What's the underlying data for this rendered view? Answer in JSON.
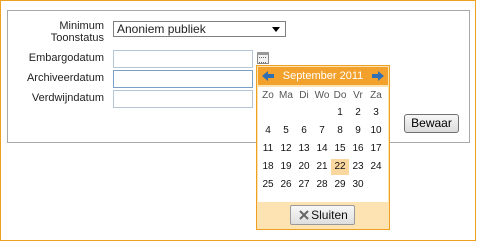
{
  "form": {
    "min_label_1": "Minimum",
    "min_label_2": "Toonstatus",
    "min_value": "Anoniem publiek",
    "embargo_label": "Embargodatum",
    "archive_label": "Archiveerdatum",
    "disappear_label": "Verdwijndatum",
    "embargo_value": "",
    "archive_value": "",
    "disappear_value": "",
    "save_label": "Bewaar"
  },
  "calendar": {
    "title": "September 2011",
    "weekdays": [
      "Zo",
      "Ma",
      "Di",
      "Wo",
      "Do",
      "Vr",
      "Za"
    ],
    "first_weekday_index": 4,
    "days_in_month": 30,
    "selected_day": 22,
    "close_label": "Sluiten"
  },
  "colors": {
    "accent": "#f2a12c",
    "selected_bg": "#fbd7a0",
    "popup_bg": "#fde2b2",
    "nav_arrow": "#2f6fb6"
  },
  "icons": {
    "calendar_button": "calendar-icon",
    "prev": "arrow-left-icon",
    "next": "arrow-right-icon",
    "close": "close-x-icon"
  }
}
